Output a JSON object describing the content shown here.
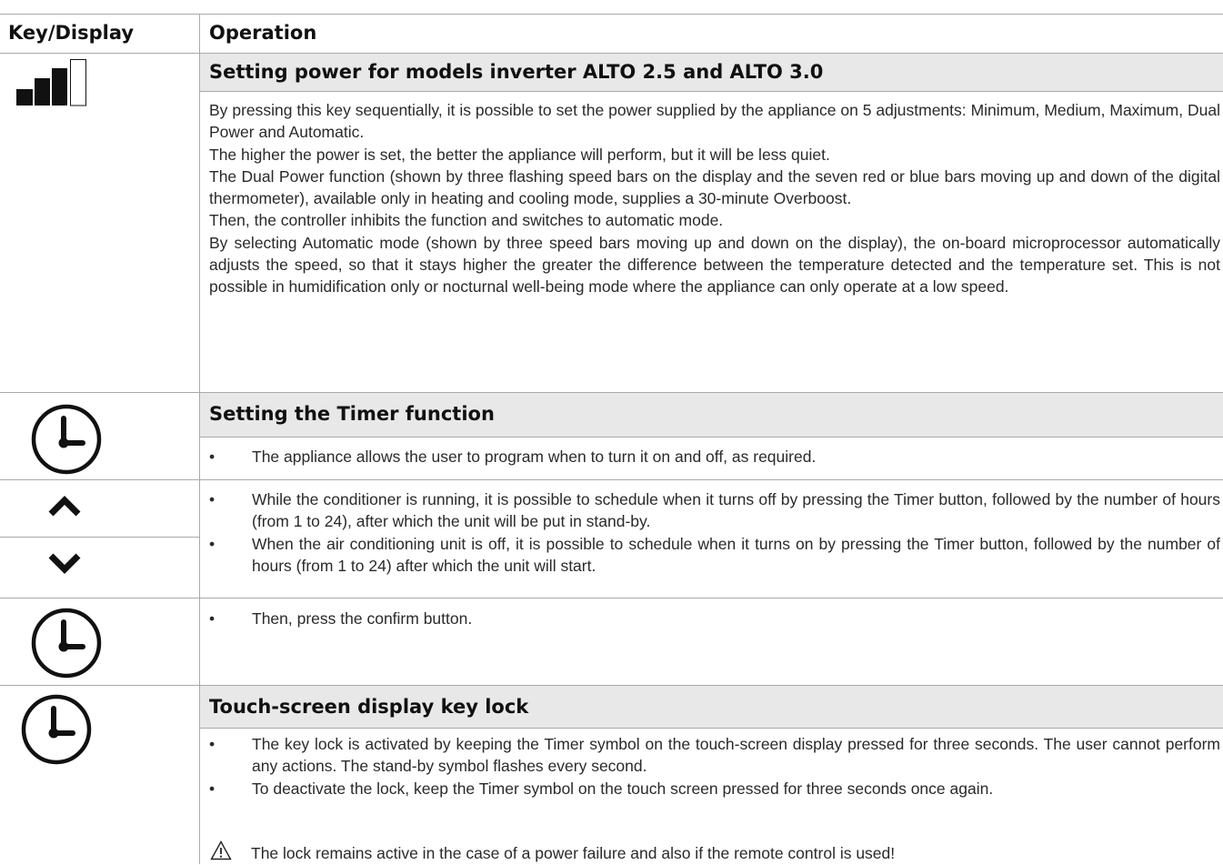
{
  "header": {
    "col1": "Key/Display",
    "col2": "Operation"
  },
  "power": {
    "title": "Setting power for models inverter ALTO 2.5 and ALTO 3.0",
    "paragraphs": [
      "By pressing this key sequentially, it is possible to set the power supplied by the appliance on 5 adjustments: Minimum, Medium, Maximum, Dual Power and Automatic.",
      "The higher the power is set, the better the appliance will perform, but it will be less quiet.",
      "The Dual Power function (shown by three flashing speed bars on the display and the seven red or blue bars moving up and down of the digital thermometer), available only in heating and cooling mode, supplies a 30-minute Overboost.",
      "Then, the controller inhibits the function and switches to automatic mode.",
      "By selecting Automatic mode (shown by three speed bars moving up and down on the display), the on-board microprocessor automatically adjusts the speed, so that it stays higher the greater the difference between the temperature detected and the temperature set. This is not possible in humidification only or nocturnal well-being mode where the appliance can only operate at a low speed."
    ]
  },
  "timer": {
    "title": "Setting the Timer function",
    "bullet": "The appliance allows the user to program when to turn it on and off, as required."
  },
  "arrows": {
    "bullets": [
      "While the conditioner is running, it is possible to schedule when it turns off by pressing the Timer button, followed by the number of hours (from 1 to 24), after which the unit will be put in stand-by.",
      "When the air conditioning unit is off, it is possible to schedule when it turns on by pressing the Timer button, followed by the number of hours (from 1 to 24) after which the unit will start."
    ]
  },
  "confirm": {
    "bullet": "Then, press the confirm button."
  },
  "keylock": {
    "title": "Touch-screen display key lock",
    "bullets": [
      "The key lock is activated by keeping the Timer symbol on the touch-screen display pressed for three seconds. The user cannot perform any actions. The stand-by symbol flashes every second.",
      "To deactivate the lock, keep the Timer symbol on the touch screen pressed for three seconds once again."
    ],
    "warning": "The lock remains active in the case of a power failure and also if the remote control is used!"
  },
  "icons": {
    "power": "power-bars-icon",
    "timer": "clock-icon",
    "up": "chevron-up-icon",
    "down": "chevron-down-icon",
    "warning": "warning-triangle-icon"
  }
}
